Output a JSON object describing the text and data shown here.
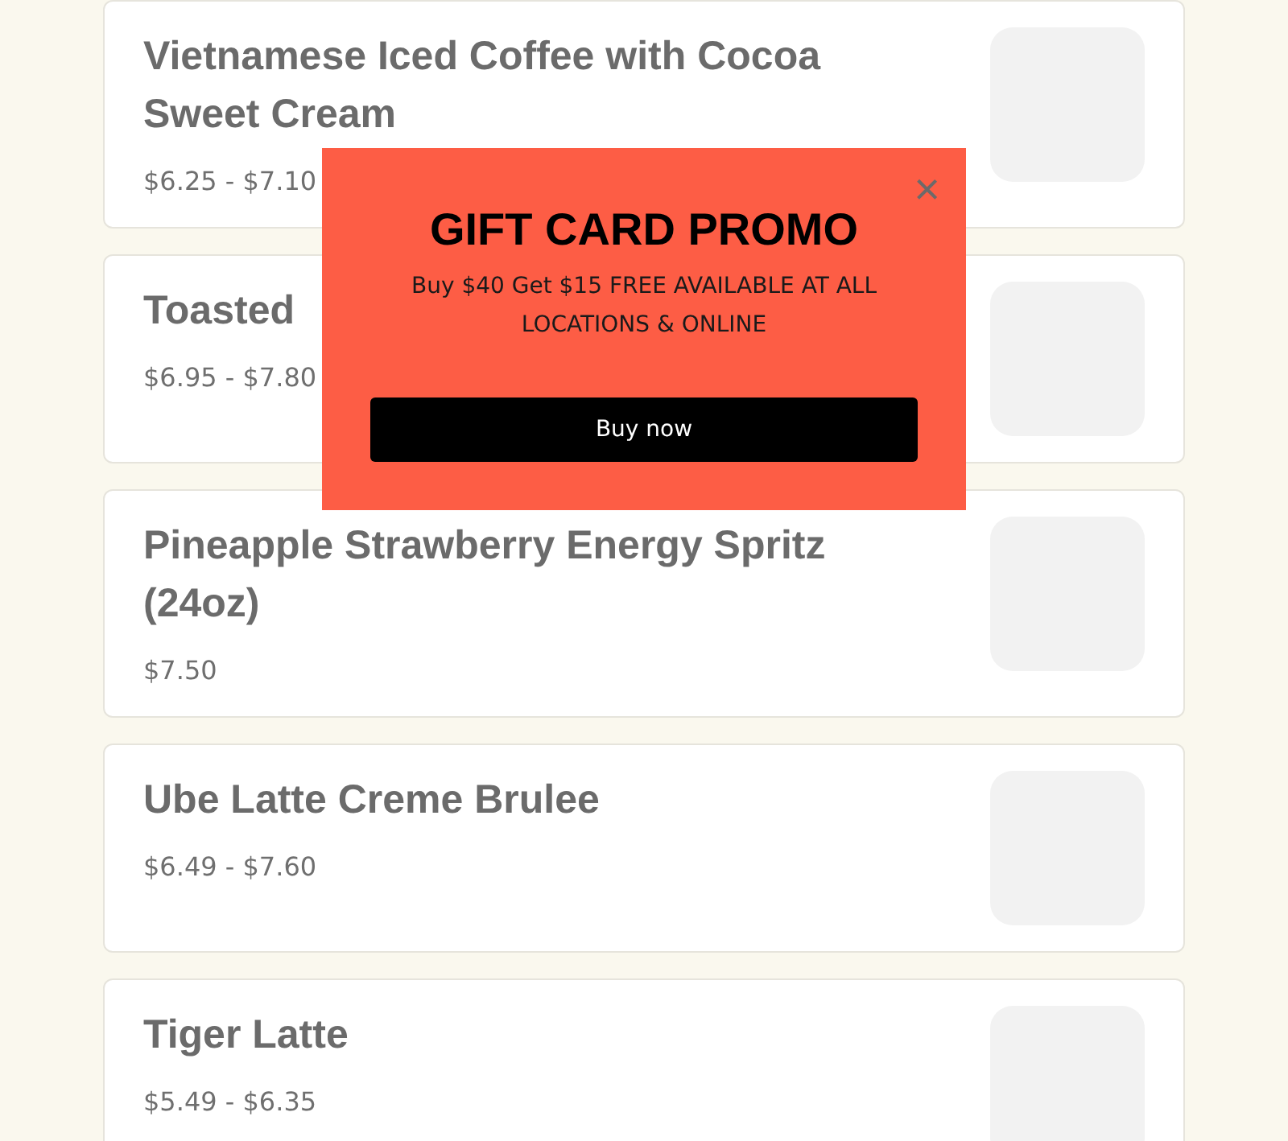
{
  "menu_items": [
    {
      "name": "Vietnamese Iced Coffee with Cocoa Sweet Cream",
      "price": "$6.25 - $7.10"
    },
    {
      "name": "Toasted",
      "price": "$6.95 - $7.80"
    },
    {
      "name": "Pineapple Strawberry Energy Spritz (24oz)",
      "price": "$7.50"
    },
    {
      "name": "Ube Latte Creme Brulee",
      "price": "$6.49 - $7.60"
    },
    {
      "name": "Tiger Latte",
      "price": "$5.49 - $6.35"
    }
  ],
  "popup": {
    "close": "×",
    "title": "GIFT CARD PROMO",
    "text": "Buy $40 Get $15 FREE AVAILABLE AT ALL LOCATIONS & ONLINE",
    "button": "Buy now"
  }
}
